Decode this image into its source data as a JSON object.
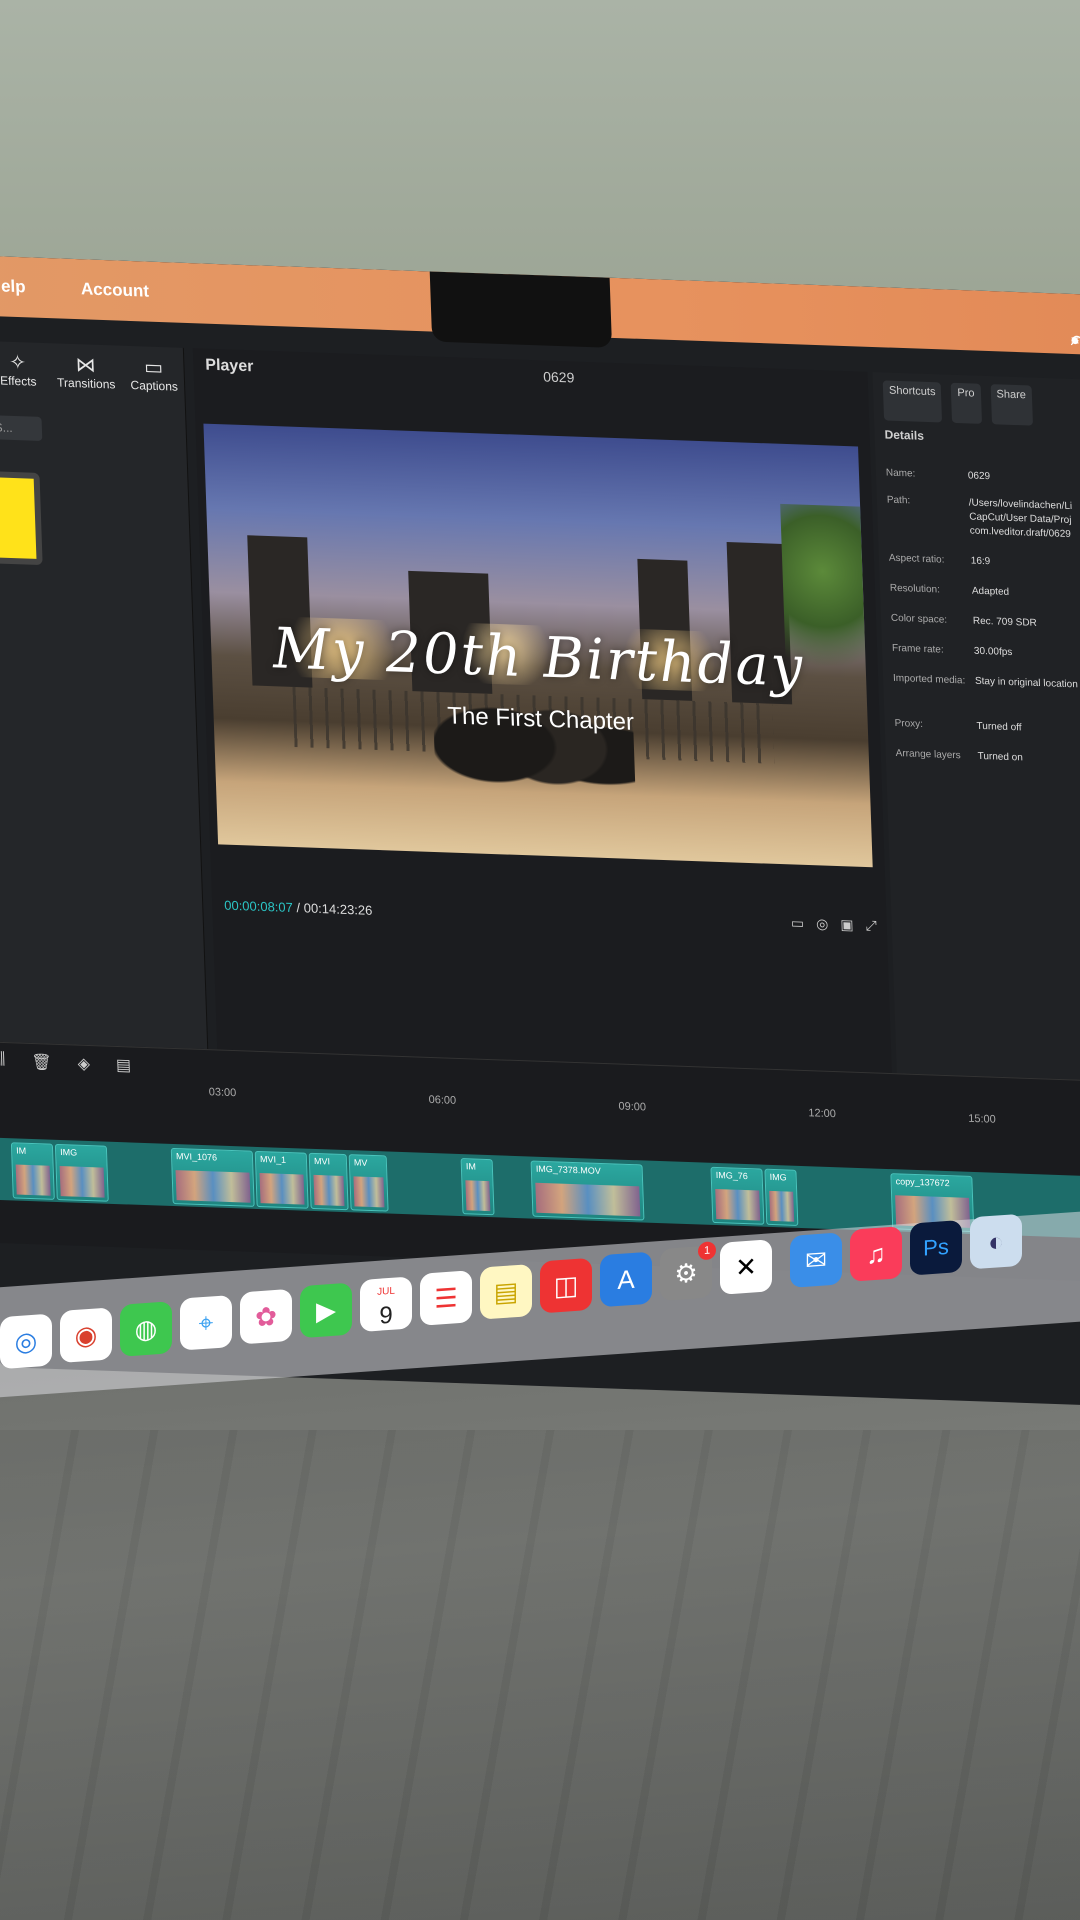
{
  "menubar": {
    "help": "elp",
    "account": "Account"
  },
  "tools": [
    {
      "label": "Effects",
      "icon": "✧"
    },
    {
      "label": "Transitions",
      "icon": "⋈"
    },
    {
      "label": "Captions",
      "icon": "▭"
    }
  ],
  "left_panel": {
    "search_placeholder": "Q S..."
  },
  "player": {
    "title": "Player",
    "project_name": "0629",
    "current_time": "00:00:08:07",
    "total_time": "00:14:23:26",
    "video_title": "My 20th Birthday",
    "video_subtitle": "The First Chapter"
  },
  "details": {
    "tabs": [
      "Shortcuts",
      "Pro",
      "Share"
    ],
    "heading": "Details",
    "rows": [
      {
        "label": "Name:",
        "value": "0629"
      },
      {
        "label": "Path:",
        "value": "/Users/lovelindachen/Li"
      },
      {
        "label": "",
        "value": "CapCut/User Data/Proj"
      },
      {
        "label": "",
        "value": "com.lveditor.draft/0629"
      },
      {
        "label": "Aspect ratio:",
        "value": "16:9"
      },
      {
        "label": "Resolution:",
        "value": "Adapted"
      },
      {
        "label": "Color space:",
        "value": "Rec. 709 SDR"
      },
      {
        "label": "Frame rate:",
        "value": "30.00fps"
      },
      {
        "label": "Imported media:",
        "value": "Stay in original location"
      },
      {
        "label": "Proxy:",
        "value": "Turned off"
      },
      {
        "label": "Arrange layers",
        "value": "Turned on"
      }
    ]
  },
  "timeline": {
    "ruler": [
      "03:00",
      "06:00",
      "09:00",
      "12:00",
      "15:00"
    ],
    "clips": [
      "IM",
      "IMG",
      "MVI_1076",
      "MVI_1",
      "MVI",
      "MV",
      "IM",
      "IMG_7378.MOV",
      "IMG_76",
      "IMG",
      "copy_137672"
    ]
  },
  "dock": {
    "calendar_month": "JUL",
    "calendar_day": "9",
    "badge": "1"
  }
}
